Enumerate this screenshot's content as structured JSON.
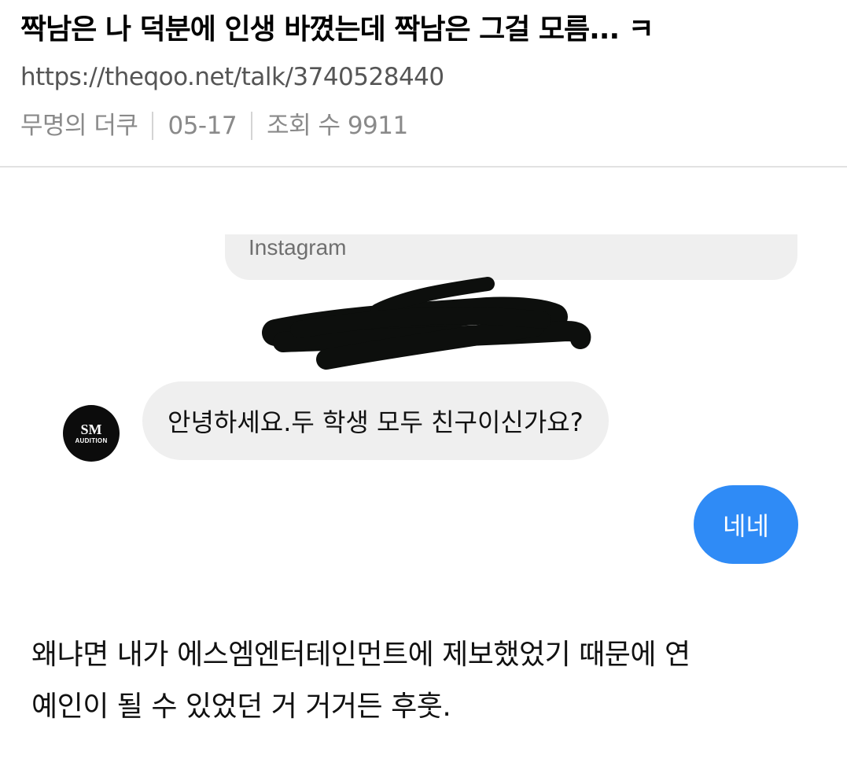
{
  "post": {
    "title": "짝남은 나 덕분에 인생 바꼈는데 짝남은 그걸 모름... ㅋ",
    "url": "https://theqoo.net/talk/3740528440",
    "author": "무명의 더쿠",
    "date": "05-17",
    "views": "조회 수 9911"
  },
  "screenshot": {
    "source_label": "Instagram",
    "avatar_logo": "SM",
    "avatar_caption": "AUDITION",
    "incoming_message": "안녕하세요.두 학생 모두 친구이신가요?",
    "outgoing_message": "네네"
  },
  "body": {
    "line1": "왜냐면 내가 에스엠엔터테인먼트에 제보했었기 때문에 연",
    "line2": "예인이 될 수 있었던 거 거거든 후훗."
  },
  "colors": {
    "outgoing_bubble": "#2f8bf6",
    "incoming_bubble": "#efefef",
    "scribble": "#0d0f0d"
  }
}
